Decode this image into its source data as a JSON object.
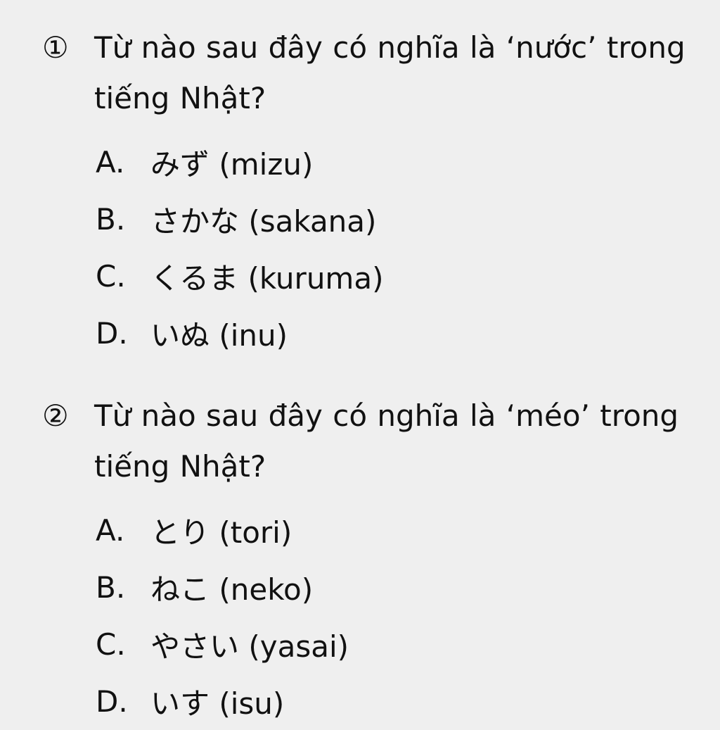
{
  "questions": [
    {
      "number": "①",
      "text": "Từ nào sau đây có nghĩa là ‘nước’ trong tiếng Nhật?",
      "options": [
        {
          "letter": "A.",
          "text": "みず (mizu)"
        },
        {
          "letter": "B.",
          "text": "さかな (sakana)"
        },
        {
          "letter": "C.",
          "text": "くるま (kuruma)"
        },
        {
          "letter": "D.",
          "text": "いぬ (inu)"
        }
      ]
    },
    {
      "number": "②",
      "text": "Từ nào sau đây có nghĩa là ‘méo’ trong tiếng Nhật?",
      "options": [
        {
          "letter": "A.",
          "text": "とり (tori)"
        },
        {
          "letter": "B.",
          "text": "ねこ (neko)"
        },
        {
          "letter": "C.",
          "text": "やさい (yasai)"
        },
        {
          "letter": "D.",
          "text": "いす (isu)"
        }
      ]
    }
  ]
}
